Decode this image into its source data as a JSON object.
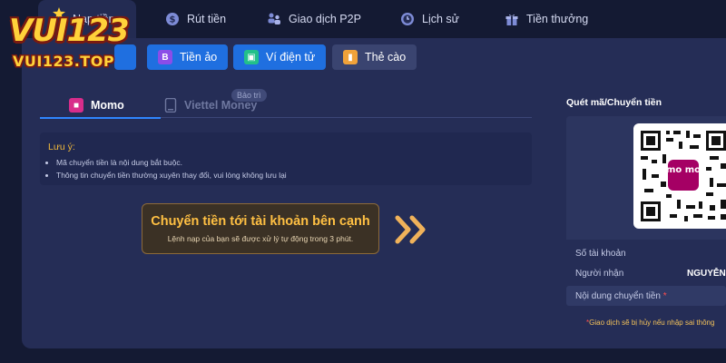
{
  "nav": {
    "items": [
      {
        "label": "Nạp tiền"
      },
      {
        "label": "Rút tiền"
      },
      {
        "label": "Giao dịch P2P"
      },
      {
        "label": "Lịch sử"
      },
      {
        "label": "Tiền thưởng"
      }
    ]
  },
  "logo": {
    "main": "VUI123",
    "sub": "VUI123.TOP"
  },
  "methods": [
    {
      "label": "Tiền ảo",
      "icon": "bitcoin-icon"
    },
    {
      "label": "Ví điện tử",
      "icon": "wallet-icon"
    },
    {
      "label": "Thẻ cào",
      "icon": "scratch-card-icon"
    }
  ],
  "subtabs": {
    "momo": "Momo",
    "viettel": "Viettel Money",
    "maintenance_badge": "Bảo trì"
  },
  "note": {
    "title": "Lưu ý:",
    "items": [
      "Mã chuyển tiền là nội dung bắt buộc.",
      "Thông tin chuyển tiền thường xuyên thay đổi, vui lòng không lưu lại"
    ]
  },
  "transfer": {
    "title": "Chuyển tiền tới tài khoản bên cạnh",
    "subtitle": "Lệnh nạp của bạn sẽ được xử lý tự động trong 3 phút."
  },
  "right": {
    "title": "Quét mã/Chuyển tiền",
    "qr_logo": "mo mo",
    "account_label": "Số tài khoản",
    "receiver_label": "Người nhận",
    "receiver_value": "NGUYỄN",
    "content_label": "Nội dung chuyển tiền",
    "required_mark": "*",
    "footnote": "Giao dịch sẽ bị hủy nếu nhập sai thông",
    "footnote_mark": "*"
  },
  "colors": {
    "background": "#141a33",
    "panel": "#252d56",
    "accent_blue": "#1f6fe0",
    "gold": "#ffc043"
  }
}
